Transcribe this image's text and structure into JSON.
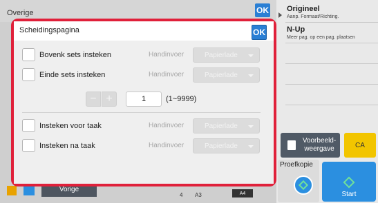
{
  "background": {
    "title": "Overige",
    "ok_label": "OK",
    "right_panel": {
      "items": [
        {
          "title": "Origineel",
          "subtitle": "Aanp. Formaat/Richting."
        },
        {
          "title": "N-Up",
          "subtitle": "Meer pag. op een pag. plaatsen"
        }
      ],
      "preview_label": "Voorbeeld-\nweergave",
      "ca_label": "CA",
      "proof_label": "Proefkopie",
      "start_label": "Start"
    },
    "bottom_bar": {
      "prev_label": "Vorige",
      "page_number": "4",
      "paper_a3": "A3",
      "paper_a4": "A4"
    }
  },
  "dialog": {
    "title": "Scheidingspagina",
    "ok_label": "OK",
    "rows_top": [
      {
        "label": "Bovenk sets insteken",
        "hand": "Handinvoer",
        "select": "Papierlade"
      },
      {
        "label": "Einde sets insteken",
        "hand": "Handinvoer",
        "select": "Papierlade"
      }
    ],
    "stepper": {
      "minus": "−",
      "plus": "+",
      "value": "1",
      "range": "(1~9999)"
    },
    "rows_bottom": [
      {
        "label": "Insteken voor taak",
        "hand": "Handinvoer",
        "select": "Papierlade"
      },
      {
        "label": "Insteken na taak",
        "hand": "Handinvoer",
        "select": "Papierlade"
      }
    ]
  },
  "colors": {
    "accent_blue": "#2a7fd4",
    "dialog_border": "#e0203a",
    "ca_yellow": "#f2c500"
  }
}
